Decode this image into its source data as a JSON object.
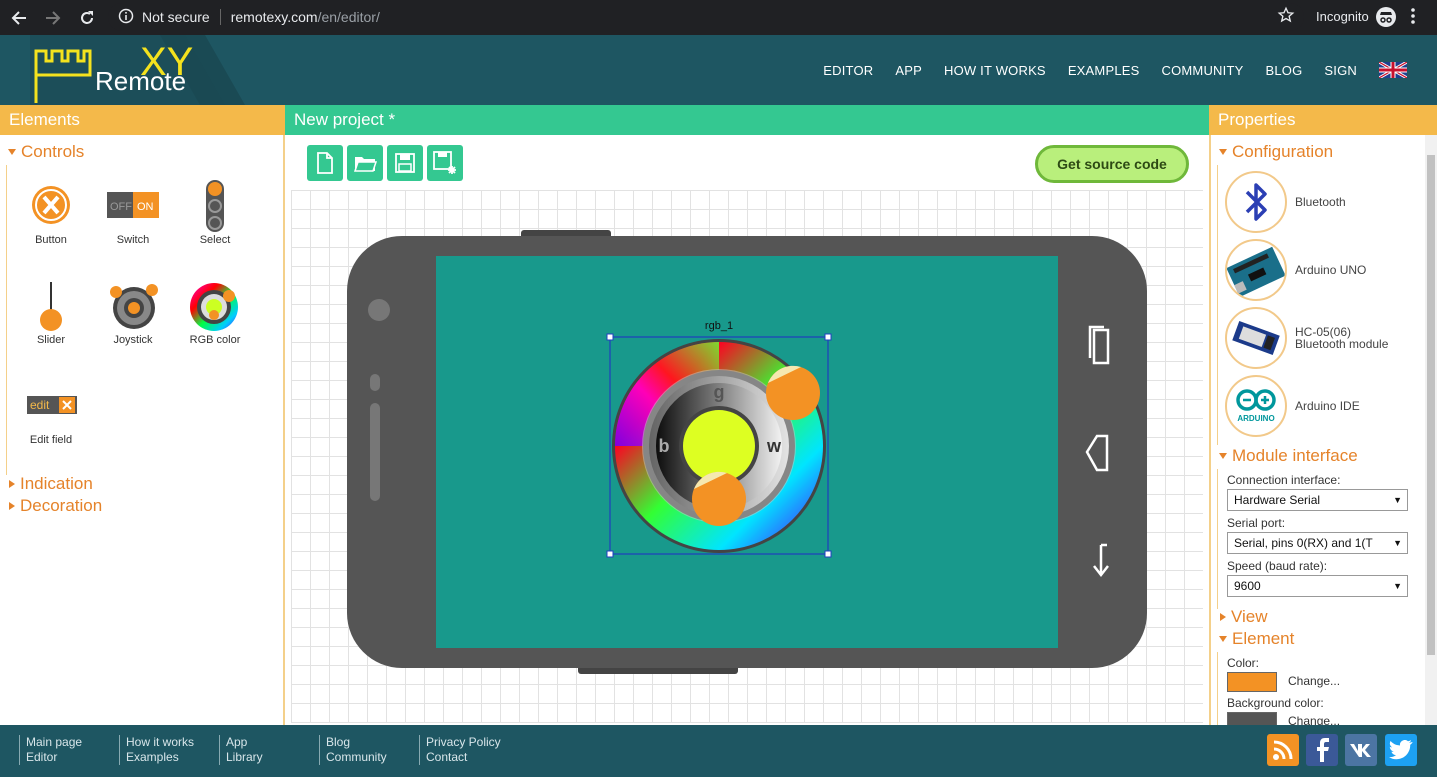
{
  "browser": {
    "security": "Not secure",
    "url_host": "remotexy.com",
    "url_path": "/en/editor/",
    "incognito_label": "Incognito"
  },
  "site": {
    "logo_text": "Remote",
    "logo_xy": "XY",
    "nav": [
      "EDITOR",
      "APP",
      "HOW IT WORKS",
      "EXAMPLES",
      "COMMUNITY",
      "BLOG",
      "SIGN"
    ]
  },
  "left": {
    "header": "Elements",
    "controls_title": "Controls",
    "elements": [
      {
        "label": "Button",
        "icon": "button-icon"
      },
      {
        "label": "Switch",
        "icon": "switch-icon"
      },
      {
        "label": "Select",
        "icon": "select-icon"
      },
      {
        "label": "Slider",
        "icon": "slider-icon"
      },
      {
        "label": "Joystick",
        "icon": "joystick-icon"
      },
      {
        "label": "RGB color",
        "icon": "rgb-color-icon"
      },
      {
        "label": "Edit field",
        "icon": "edit-field-icon"
      }
    ],
    "switch_off": "OFF",
    "switch_on": "ON",
    "edit_text": "edit",
    "indication_title": "Indication",
    "decoration_title": "Decoration"
  },
  "center": {
    "header": "New project *",
    "toolbar": [
      "new-file-icon",
      "open-folder-icon",
      "save-icon",
      "save-as-icon"
    ],
    "get_source": "Get source code",
    "element_name": "rgb_1",
    "rgb_letters": {
      "g": "g",
      "b": "b",
      "w": "w"
    },
    "screen_color": "#18998c",
    "accent_orange": "#f39224"
  },
  "right": {
    "header": "Properties",
    "configuration_title": "Configuration",
    "config": [
      {
        "label": "Bluetooth",
        "icon": "bluetooth-icon"
      },
      {
        "label": "Arduino UNO",
        "icon": "arduino-uno-icon"
      },
      {
        "label_line1": "HC-05(06)",
        "label_line2": "Bluetooth module",
        "icon": "hc05-module-icon"
      },
      {
        "label": "Arduino IDE",
        "icon": "arduino-ide-icon"
      }
    ],
    "arduino_text": "ARDUINO",
    "module_interface_title": "Module interface",
    "connection_label": "Connection interface:",
    "connection_value": "Hardware Serial",
    "serial_label": "Serial port:",
    "serial_value": "Serial, pins 0(RX) and 1(T",
    "speed_label": "Speed (baud rate):",
    "speed_value": "9600",
    "view_title": "View",
    "element_title": "Element",
    "color_label": "Color:",
    "color_change": "Change...",
    "color_value": "#f39224",
    "bg_color_label": "Background color:",
    "bg_change": "Change...",
    "bg_color_value": "#555555"
  },
  "footer": {
    "cols": [
      [
        "Main page",
        "Editor"
      ],
      [
        "How it works",
        "Examples"
      ],
      [
        "App",
        "Library"
      ],
      [
        "Blog",
        "Community"
      ],
      [
        "Privacy Policy",
        "Contact"
      ]
    ],
    "social": [
      "rss-icon",
      "facebook-icon",
      "vk-icon",
      "twitter-icon"
    ]
  }
}
